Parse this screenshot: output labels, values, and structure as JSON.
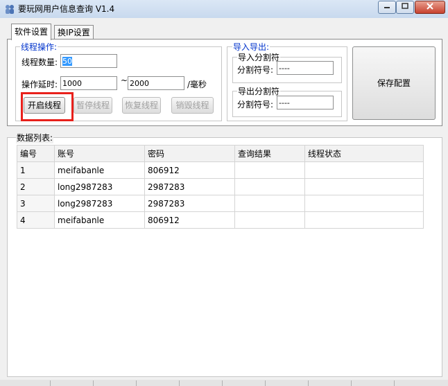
{
  "window": {
    "title": "要玩网用户信息查询 V1.4"
  },
  "tabs": [
    {
      "label": "软件设置",
      "active": true
    },
    {
      "label": "换IP设置",
      "active": false
    }
  ],
  "thread_group": {
    "legend": "线程操作:",
    "count_label": "线程数量:",
    "count_value": "50",
    "delay_label": "操作延时:",
    "delay_min": "1000",
    "tilde": "~",
    "delay_max": "2000",
    "unit": "/毫秒",
    "buttons": {
      "start": "开启线程",
      "pause": "暂停线程",
      "resume": "恢复线程",
      "destroy": "销毁线程"
    }
  },
  "io_group": {
    "legend": "导入导出:",
    "import": {
      "legend": "导入分割符",
      "label": "分割符号:",
      "value": "----"
    },
    "export": {
      "legend": "导出分割符",
      "label": "分割符号:",
      "value": "----"
    }
  },
  "save_button": "保存配置",
  "data_section": {
    "legend": "数据列表:",
    "columns": [
      "编号",
      "账号",
      "密码",
      "查询结果",
      "线程状态"
    ],
    "rows": [
      [
        "1",
        "meifabanle",
        "806912",
        "",
        ""
      ],
      [
        "2",
        "long2987283",
        "2987283",
        "",
        ""
      ],
      [
        "3",
        "long2987283",
        "2987283",
        "",
        ""
      ],
      [
        "4",
        "meifabanle",
        "806912",
        "",
        ""
      ]
    ]
  },
  "colors": {
    "accent": "#0033cc",
    "highlight": "#e8201b",
    "selection": "#3399ff"
  }
}
